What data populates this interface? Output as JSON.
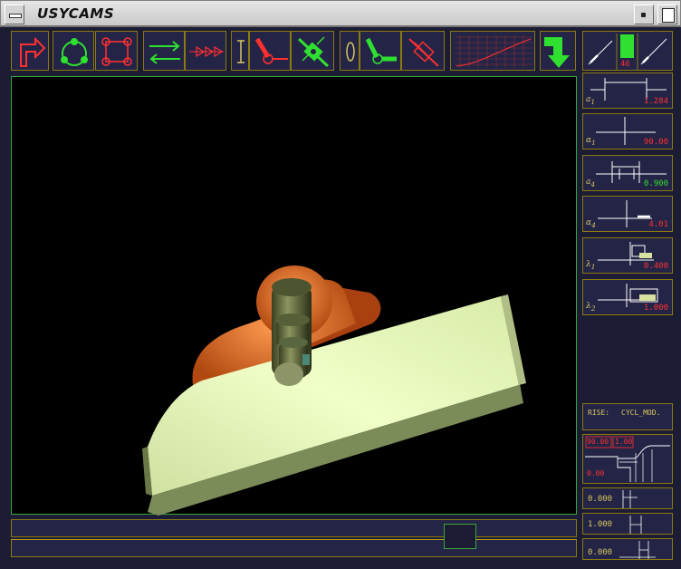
{
  "window": {
    "title": "USYCAMS"
  },
  "zoom": {
    "value": "46"
  },
  "parameters": [
    {
      "symbol": "a",
      "sub": "1",
      "value": "1.284",
      "value_color": "red"
    },
    {
      "symbol": "α",
      "sub": "1",
      "value": "90.00",
      "value_color": "red"
    },
    {
      "symbol": "a",
      "sub": "4",
      "value": "0.900",
      "value_color": "green"
    },
    {
      "symbol": "α",
      "sub": "4",
      "value": "4.01",
      "value_color": "red"
    },
    {
      "symbol": "λ",
      "sub": "1",
      "value": "0.400",
      "value_color": "red"
    },
    {
      "symbol": "λ",
      "sub": "2",
      "value": "1.000",
      "value_color": "red"
    }
  ],
  "motion": {
    "type_label": "RISE:",
    "law_label": "CYCL_MOD."
  },
  "motion_graph": {
    "angle": "90.00",
    "scale": "1.00",
    "offset": "0.00"
  },
  "bottom_values": [
    "0.000",
    "1.000",
    "0.000"
  ],
  "colors": {
    "frame": "#8a7a10",
    "accent_green": "#30e030",
    "accent_red": "#ff3030",
    "background": "#1c1c34"
  }
}
